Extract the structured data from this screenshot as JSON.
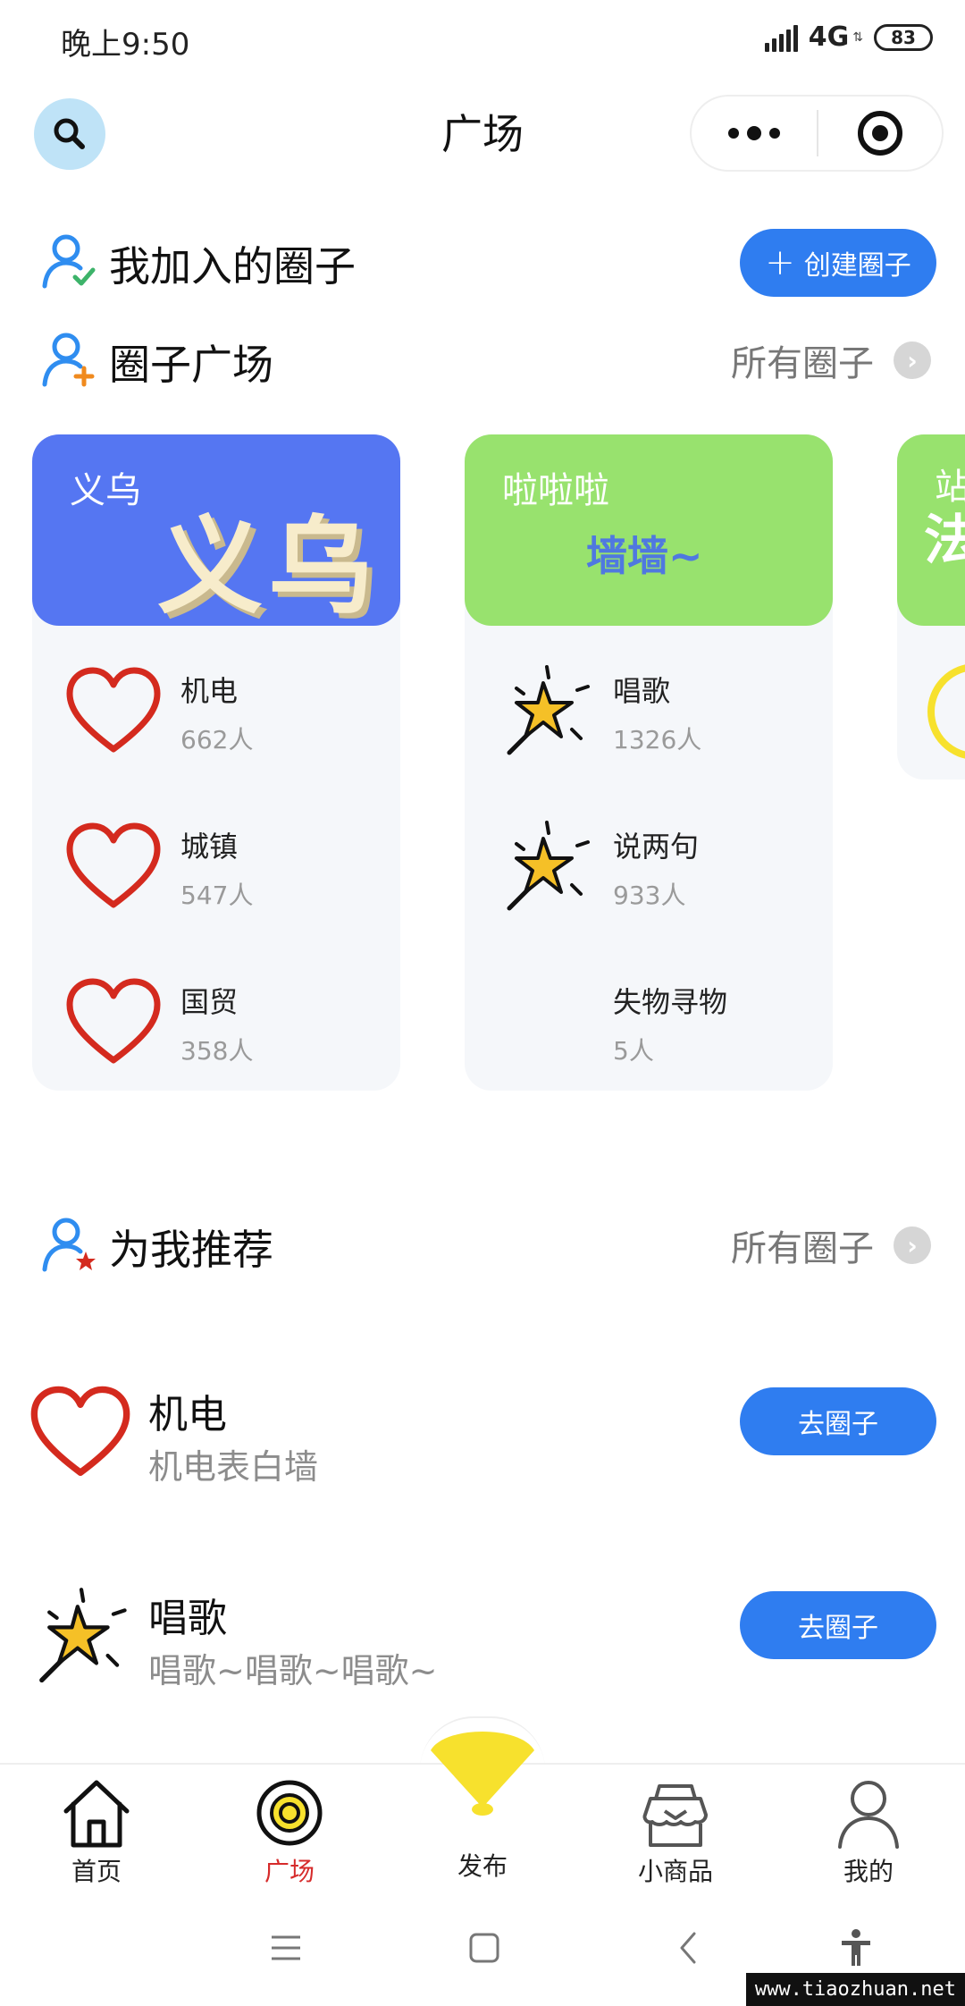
{
  "status_bar": {
    "time": "晚上9:50",
    "network": "4G",
    "battery": "83"
  },
  "header": {
    "title": "广场"
  },
  "joined": {
    "title": "我加入的圈子",
    "create_label": "创建圈子"
  },
  "plaza": {
    "title": "圈子广场",
    "all_label": "所有圈子",
    "cards": [
      {
        "name": "义乌",
        "banner_color": "#5576f2",
        "art_text": "义乌",
        "items": [
          {
            "title": "机电",
            "count": "662人",
            "icon": "heart-icon"
          },
          {
            "title": "城镇",
            "count": "547人",
            "icon": "heart-icon"
          },
          {
            "title": "国贸",
            "count": "358人",
            "icon": "heart-icon"
          }
        ]
      },
      {
        "name": "啦啦啦",
        "banner_color": "#98e26e",
        "art_text": "墙墙~",
        "items": [
          {
            "title": "唱歌",
            "count": "1326人",
            "icon": "magic-wand-icon"
          },
          {
            "title": "说两句",
            "count": "933人",
            "icon": "magic-wand-icon"
          },
          {
            "title": "失物寻物",
            "count": "5人",
            "icon": ""
          }
        ]
      },
      {
        "name": "站",
        "banner_color": "#98e26e",
        "art_text": "法"
      }
    ]
  },
  "recommend": {
    "title": "为我推荐",
    "all_label": "所有圈子",
    "items": [
      {
        "title": "机电",
        "desc": "机电表白墙",
        "button": "去圈子",
        "icon": "heart-icon"
      },
      {
        "title": "唱歌",
        "desc": "唱歌~唱歌~唱歌~",
        "button": "去圈子",
        "icon": "magic-wand-icon"
      }
    ]
  },
  "tabbar": {
    "tabs": [
      {
        "label": "首页",
        "icon": "home-icon"
      },
      {
        "label": "广场",
        "icon": "plaza-icon",
        "active": true
      },
      {
        "label": "发布",
        "icon": "fan-icon"
      },
      {
        "label": "小商品",
        "icon": "shop-icon"
      },
      {
        "label": "我的",
        "icon": "profile-icon"
      }
    ]
  },
  "colors": {
    "accent": "#2f7df0",
    "active_tab": "#d62b2b",
    "heart": "#d42a1e",
    "yellow": "#f7e12d"
  },
  "watermark": "www.tiaozhuan.net"
}
